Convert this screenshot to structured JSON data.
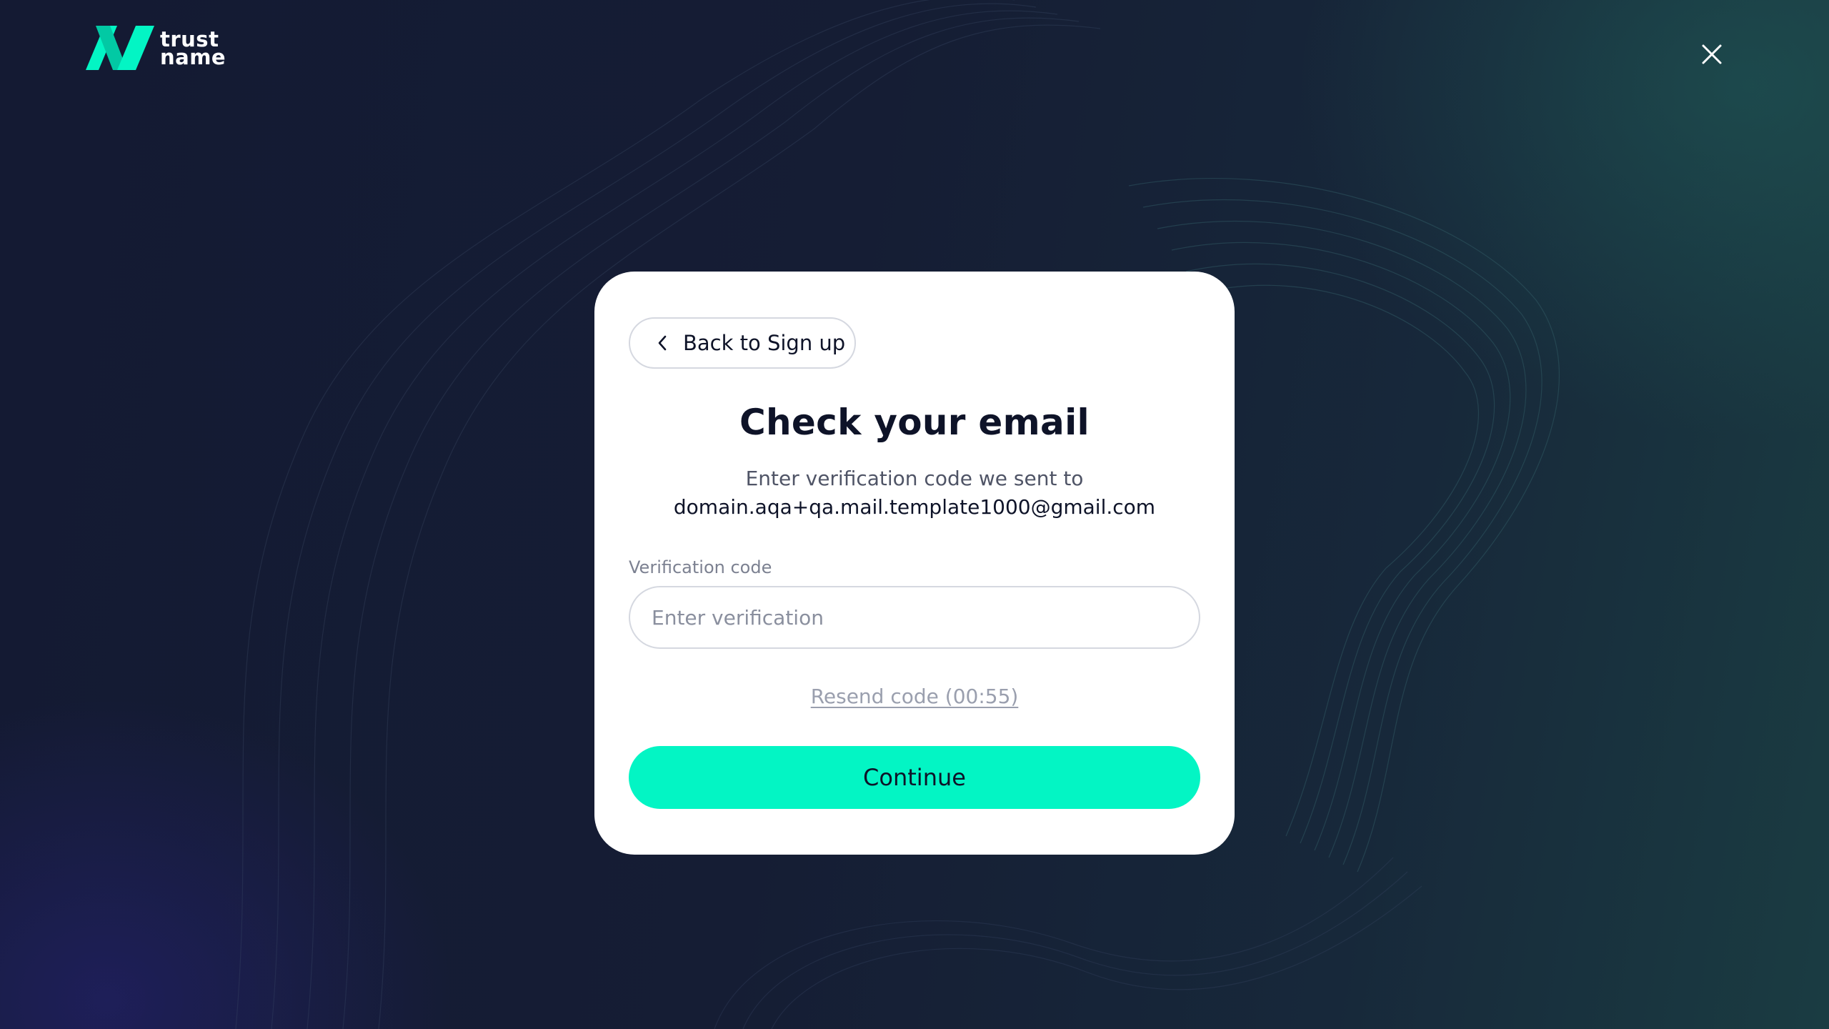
{
  "brand": {
    "logo_line1": "trust",
    "logo_line2": "name",
    "accent_color": "#03f5c4"
  },
  "header": {
    "close_icon": "close-icon"
  },
  "dialog": {
    "back_label": "Back to Sign up",
    "title": "Check your email",
    "subtitle": "Enter verification code we sent to",
    "email": "domain.aqa+qa.mail.template1000@gmail.com",
    "field_label": "Verification code",
    "input_value": "",
    "input_placeholder": "Enter verification",
    "resend_label": "Resend code (00:55)",
    "continue_label": "Continue"
  }
}
